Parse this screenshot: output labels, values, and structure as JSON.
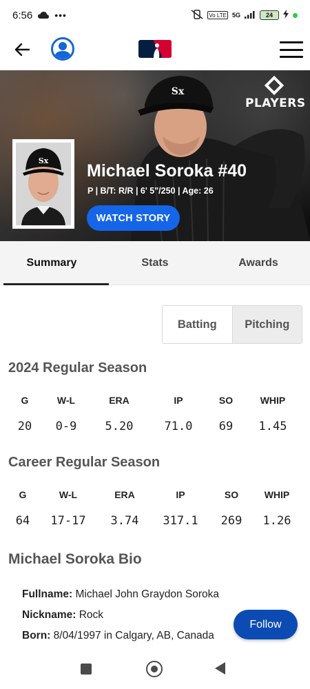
{
  "status_bar": {
    "time": "6:56",
    "battery": "24",
    "network": "5G",
    "volte": "Vo LTE"
  },
  "header": {
    "back_icon": "arrow-left-icon",
    "profile_icon": "user-circle-icon",
    "logo": "mlb-logo",
    "menu_icon": "hamburger-menu-icon"
  },
  "hero": {
    "brand_word": "PLAYERS",
    "player_name": "Michael Soroka #40",
    "meta": "P | B/T: R/R | 6' 5\"/250 | Age: 26",
    "watch_label": "WATCH STORY"
  },
  "tabs": [
    {
      "label": "Summary",
      "active": true
    },
    {
      "label": "Stats",
      "active": false
    },
    {
      "label": "Awards",
      "active": false
    }
  ],
  "toggle": {
    "batting": "Batting",
    "pitching": "Pitching",
    "selected": "Pitching"
  },
  "season": {
    "title": "2024 Regular Season",
    "headers": [
      "G",
      "W-L",
      "ERA",
      "IP",
      "SO",
      "WHIP"
    ],
    "values": [
      "20",
      "0-9",
      "5.20",
      "71.0",
      "69",
      "1.45"
    ]
  },
  "career": {
    "title": "Career Regular Season",
    "headers": [
      "G",
      "W-L",
      "ERA",
      "IP",
      "SO",
      "WHIP"
    ],
    "values": [
      "64",
      "17-17",
      "3.74",
      "317.1",
      "269",
      "1.26"
    ]
  },
  "bio": {
    "title": "Michael Soroka Bio",
    "fullname_label": "Fullname:",
    "fullname": "Michael John Graydon Soroka",
    "nickname_label": "Nickname:",
    "nickname": "Rock",
    "born_label": "Born:",
    "born": "8/04/1997 in Calgary, AB, Canada"
  },
  "follow_label": "Follow",
  "colors": {
    "accent_blue": "#1565e8",
    "follow_blue": "#0b4bb3",
    "mlb_red": "#d50032",
    "mlb_navy": "#041e42"
  }
}
